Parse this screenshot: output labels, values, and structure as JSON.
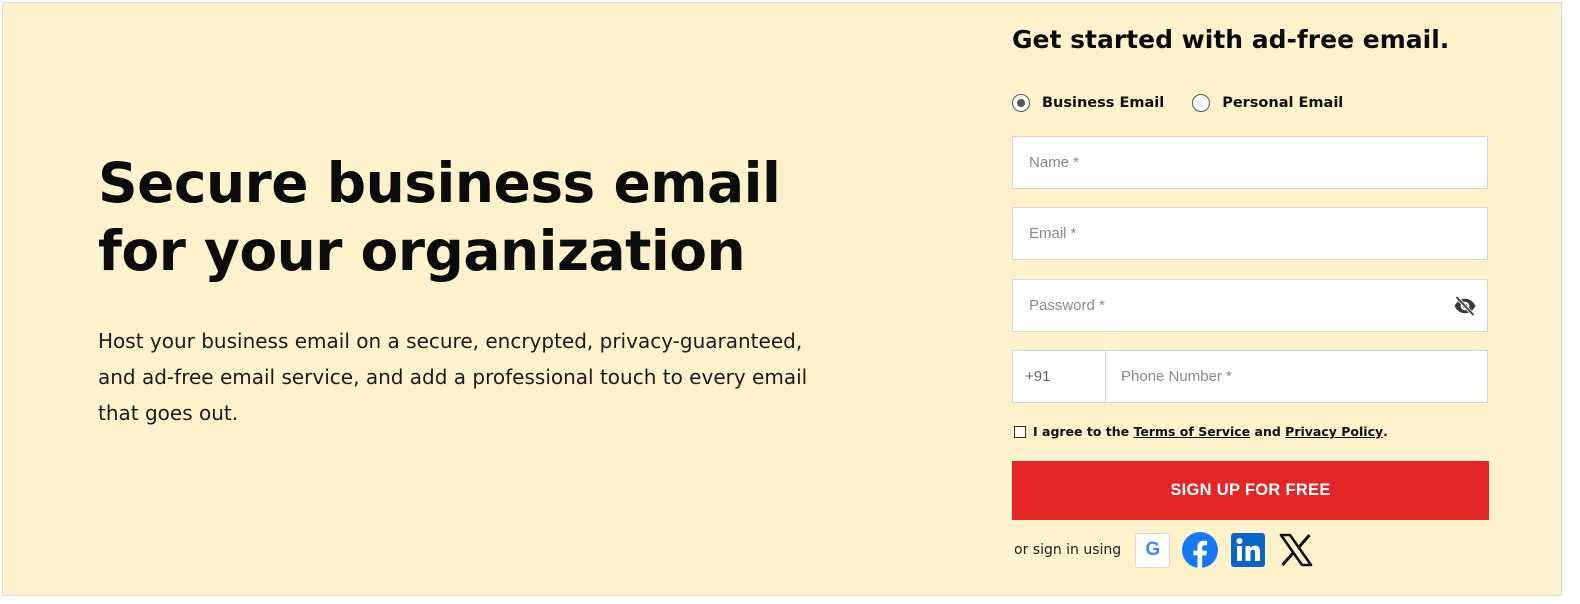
{
  "hero": {
    "title": "Secure business email for your organization",
    "description": "Host your business email on a secure, encrypted, privacy-guaranteed, and ad-free email service, and add a professional touch to every email that goes out."
  },
  "form": {
    "title": "Get started with ad-free email.",
    "account_types": [
      {
        "label": "Business Email",
        "selected": true
      },
      {
        "label": "Personal Email",
        "selected": false
      }
    ],
    "name_placeholder": "Name *",
    "email_placeholder": "Email *",
    "password_placeholder": "Password *",
    "phone_code": "+91",
    "phone_placeholder": "Phone Number *",
    "agree": {
      "prefix": "I agree to the ",
      "terms": "Terms of Service",
      "middle": " and ",
      "privacy": "Privacy Policy",
      "suffix": "."
    },
    "submit_label": "SIGN UP FOR FREE",
    "social": {
      "label": "or sign in using",
      "providers": [
        "google-icon",
        "facebook-icon",
        "linkedin-icon",
        "x-icon"
      ],
      "google_glyph": "G"
    }
  },
  "colors": {
    "background": "#fef2cd",
    "submit": "#e42527",
    "facebook": "#1877f2",
    "linkedin": "#0a66c2"
  }
}
